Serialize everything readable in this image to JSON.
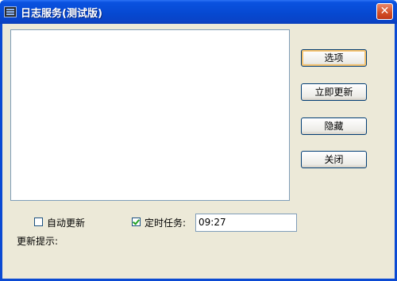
{
  "window": {
    "title": "日志服务(测试版)",
    "close_glyph": "✕"
  },
  "buttons": {
    "options": "选项",
    "update_now": "立即更新",
    "hide": "隐藏",
    "close": "关闭"
  },
  "auto_update": {
    "label": "自动更新",
    "checked": false
  },
  "scheduled_task": {
    "label": "定时任务:",
    "checked": true,
    "time_value": "09:27"
  },
  "update_hint": {
    "label": "更新提示:"
  },
  "icons": {
    "app": "app-window-icon",
    "close": "close-icon",
    "check": "checkmark-icon"
  },
  "colors": {
    "titlebar": "#0648d0",
    "window_bg": "#ece9d8",
    "close_button": "#d24d25",
    "checkmark": "#21a121"
  }
}
